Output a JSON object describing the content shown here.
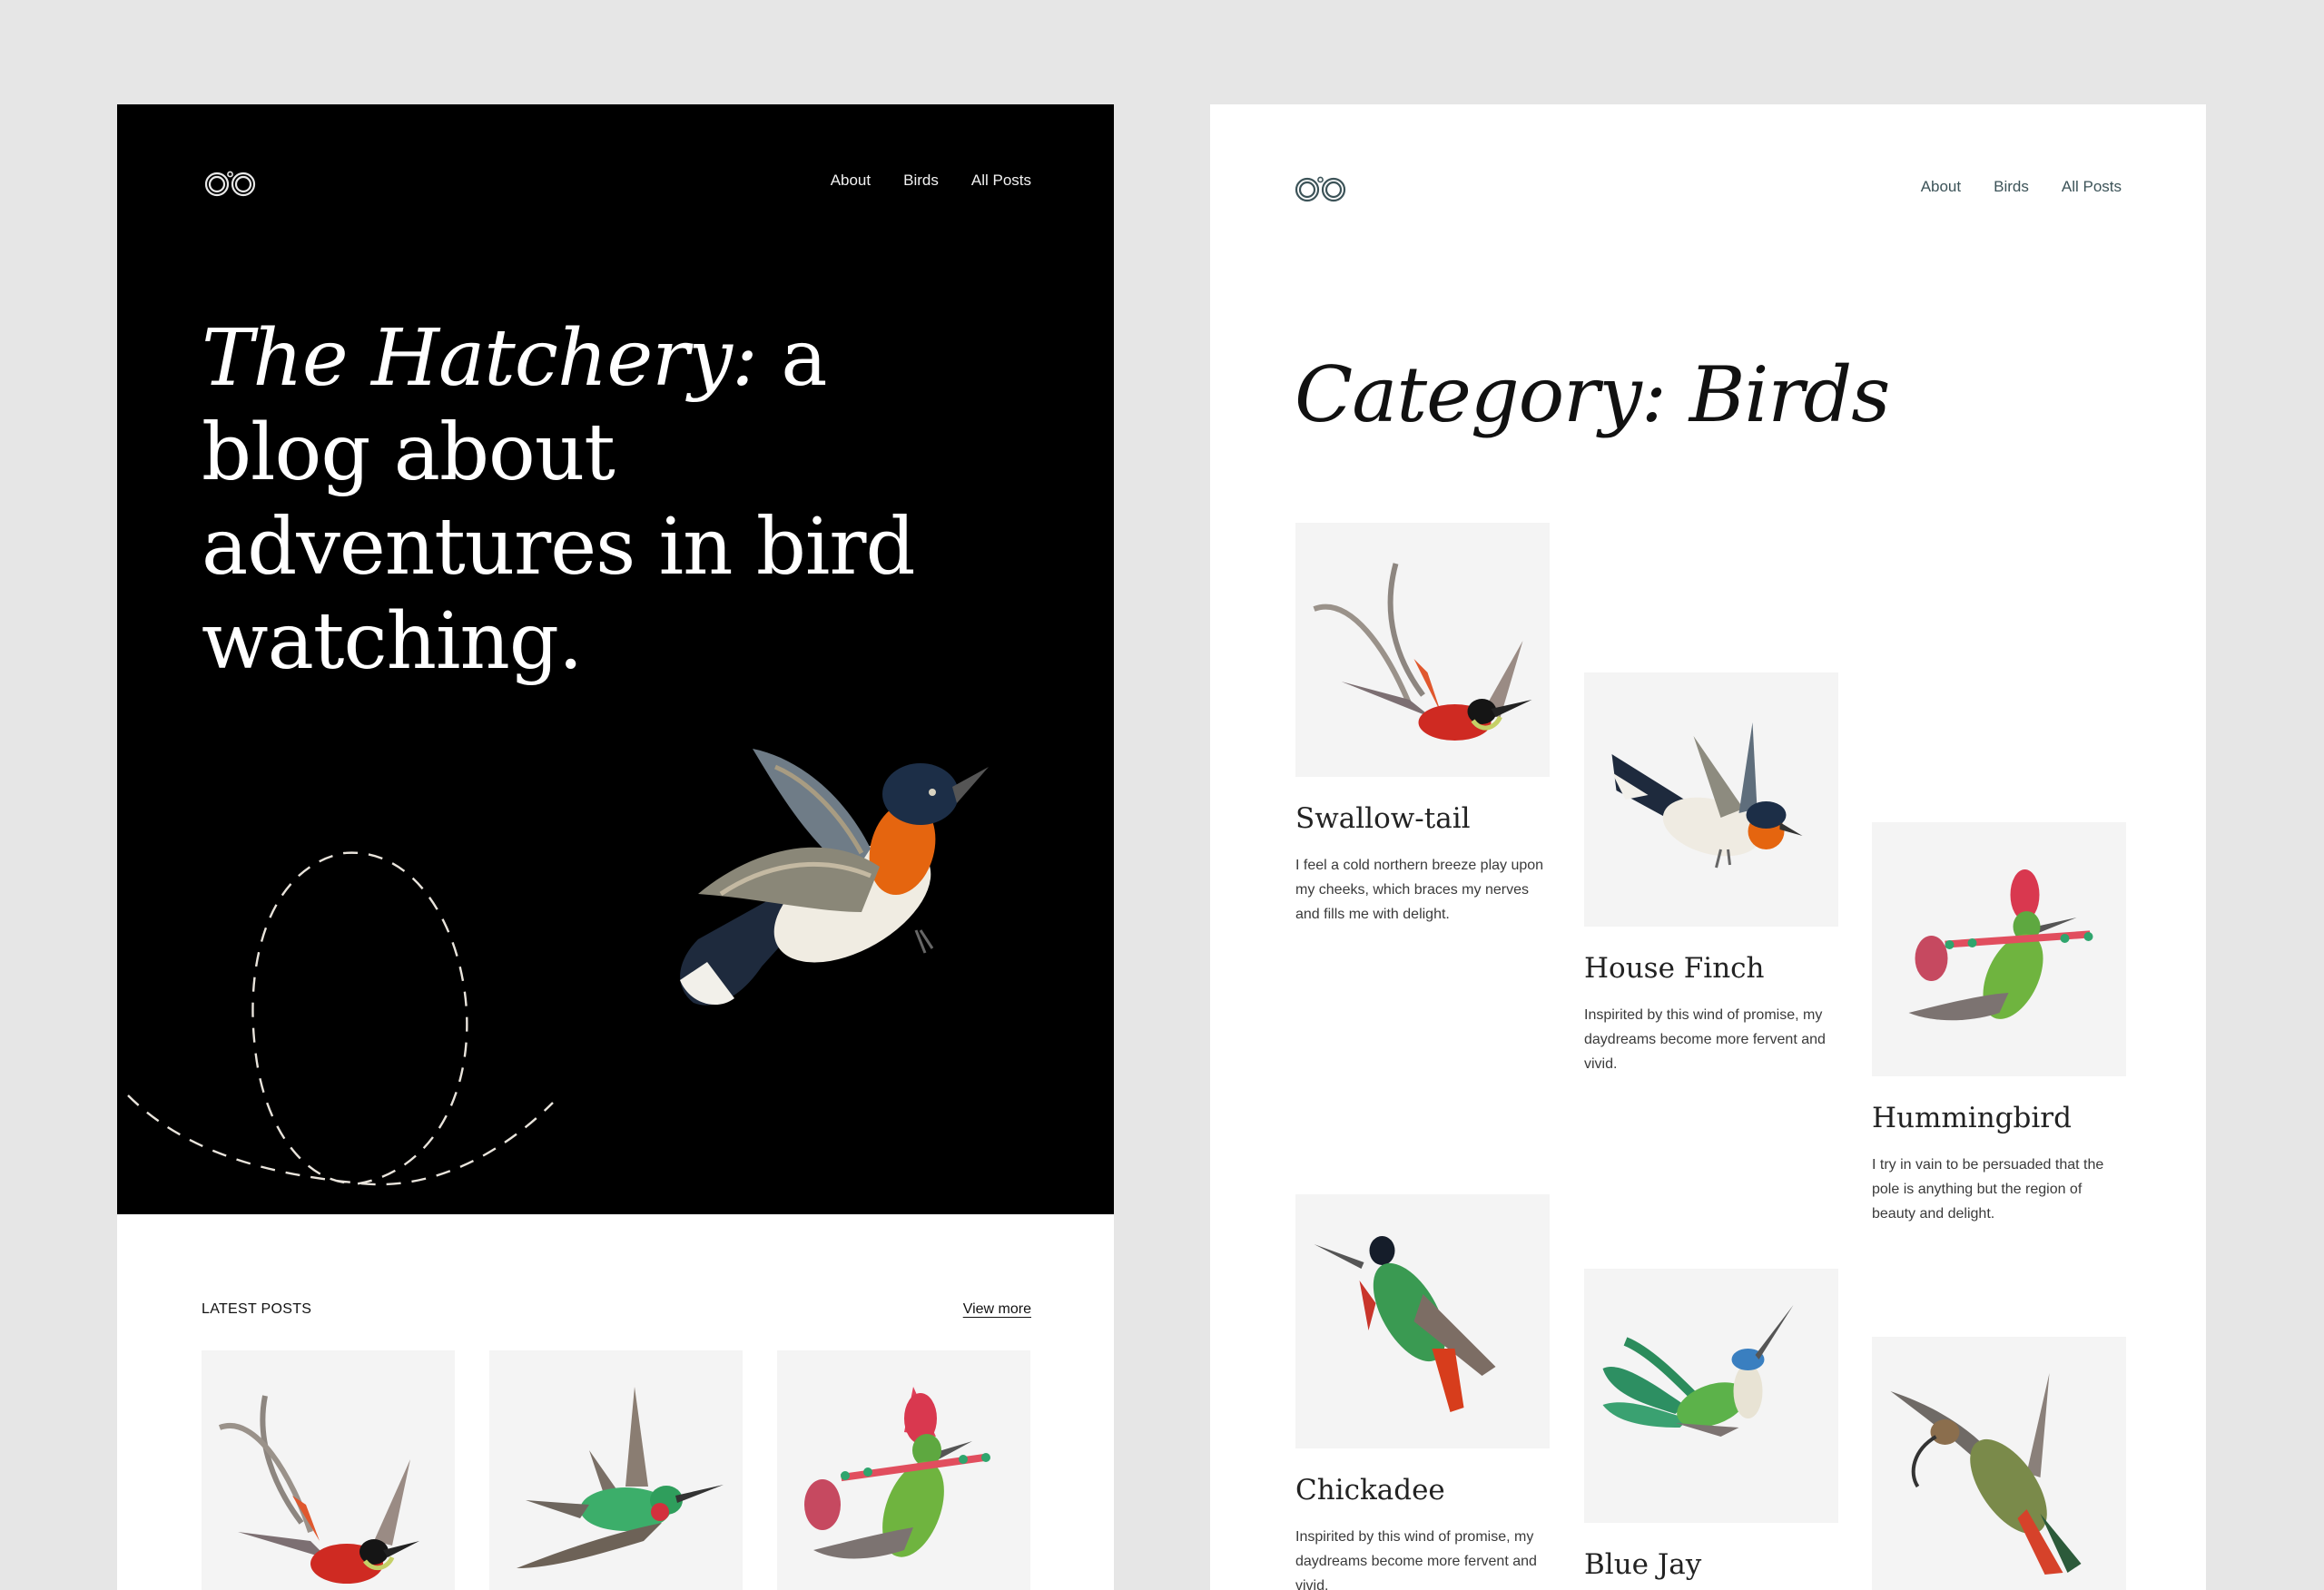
{
  "colors": {
    "page_background": "#e6e6e6",
    "hero_background": "#000000",
    "nav_dark": "#f2f2f2",
    "nav_light": "#3c5358",
    "card_background": "#f4f4f4"
  },
  "left_page": {
    "logo": "binoculars-logo",
    "nav": [
      {
        "label": "About"
      },
      {
        "label": "Birds"
      },
      {
        "label": "All Posts"
      }
    ],
    "hero": {
      "title_italic": "The Hatchery:",
      "title_rest": " a blog about adventures in bird watching."
    },
    "latest_posts": {
      "label": "LATEST POSTS",
      "view_more": "View more",
      "cards": [
        {
          "image": "swallow-tail-illustration"
        },
        {
          "image": "green-hummingbird-illustration"
        },
        {
          "image": "crested-hummingbird-illustration"
        }
      ]
    }
  },
  "right_page": {
    "logo": "binoculars-logo",
    "nav": [
      {
        "label": "About"
      },
      {
        "label": "Birds"
      },
      {
        "label": "All Posts"
      }
    ],
    "title": "Category: Birds",
    "posts": [
      {
        "title": "Swallow-tail",
        "excerpt": "I feel a cold northern breeze play upon my cheeks, which braces my nerves and fills me with delight."
      },
      {
        "title": "House Finch",
        "excerpt": "Inspirited by this wind of promise, my daydreams become more fervent and vivid."
      },
      {
        "title": "Hummingbird",
        "excerpt": "I try in vain to be persuaded that the pole is anything but the region of beauty and delight."
      },
      {
        "title": "Chickadee",
        "excerpt": "Inspirited by this wind of promise, my daydreams become more fervent and vivid."
      },
      {
        "title": "Blue Jay",
        "excerpt": ""
      },
      {
        "title": "",
        "excerpt": ""
      }
    ]
  }
}
